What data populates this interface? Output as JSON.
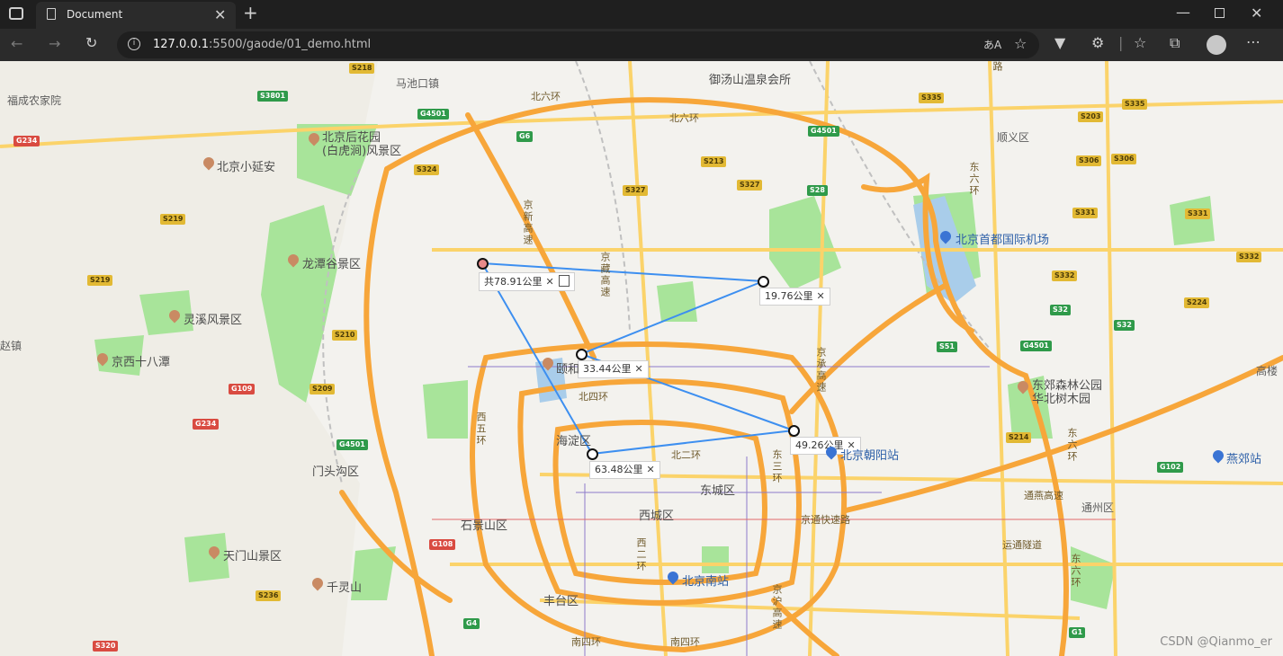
{
  "browser": {
    "tab_title": "Document",
    "url_host": "127.0.0.1",
    "url_rest": ":5500/gaode/01_demo.html",
    "translate_label": "あA"
  },
  "map": {
    "labels": {
      "fucheng": "福成农家院",
      "houhuayuan_1": "北京后花园",
      "houhuayuan_2": "(白虎涧)风景区",
      "xiaoyanan": "北京小延安",
      "longtangu": "龙潭谷景区",
      "lingxi": "灵溪风景区",
      "jingxi18": "京西十八潭",
      "chiqiao": "赵镇",
      "machikou": "马池口镇",
      "yutangshan": "御汤山温泉会所",
      "beiliuhuan_1": "北六环",
      "beiliuhuan_2": "北六环",
      "shunyi": "顺义区",
      "airport": "北京首都国际机场",
      "dongjiao": "东郊森林公园",
      "huabei": "华北树木园",
      "gaolou": "高楼",
      "yanjiao": "燕郊站",
      "tongzhou": "通州区",
      "haidian": "海淀区",
      "mentougou": "门头沟区",
      "shijingshan": "石景山区",
      "fengtai": "丰台区",
      "xicheng": "西城区",
      "dongcheng": "东城区",
      "chaoyang_station": "北京朝阳站",
      "south_station": "北京南站",
      "beisihuan": "北四环",
      "beierhuan": "北二环",
      "nansihuan_1": "南四环",
      "nansihuan_2": "南四环",
      "tongyan": "通燕高速",
      "yuntong": "运通隧道",
      "jingtong": "京通快速路",
      "tianmenshan": "天门山景区",
      "qianlingshan": "千灵山",
      "yihe": "颐和",
      "jingxin": "京新高速",
      "jingzang": "京藏高速",
      "jingcheng": "京承高速",
      "xiwuhuan": "西五环",
      "dongliuhuan_1": "东六环",
      "dongliuhuan_2": "东六环",
      "dongsanhuan": "东三环",
      "xierhuan": "西二环",
      "jinghu": "京沪高速",
      "dongliuhuan_3": "东六环",
      "shunyi_road": "路"
    },
    "shields": {
      "s218": "S218",
      "s3801": "S3801",
      "g4501a": "G4501",
      "g234a": "G234",
      "s219a": "S219",
      "s219b": "S219",
      "g6": "G6",
      "s324": "S324",
      "s213": "S213",
      "s327a": "S327",
      "s327b": "S327",
      "s335a": "S335",
      "s335b": "S335",
      "g4501b": "G4501",
      "s28": "S28",
      "s203": "S203",
      "s306a": "S306",
      "s306b": "S306",
      "s331a": "S331",
      "s331b": "S331",
      "s332a": "S332",
      "s332b": "S332",
      "s32a": "S32",
      "s32b": "S32",
      "s224": "S224",
      "s51": "S51",
      "g4501c": "G4501",
      "s210": "S210",
      "g109": "G109",
      "s209": "S209",
      "g234b": "G234",
      "g4501d": "G4501",
      "s214": "S214",
      "g102": "G102",
      "g108": "G108",
      "s236": "S236",
      "g4": "G4",
      "s320": "S320",
      "g1": "G1"
    },
    "measure": {
      "total": "共78.91公里",
      "seg1": "19.76公里",
      "seg2": "33.44公里",
      "seg3": "49.26公里",
      "seg4": "63.48公里"
    },
    "colors": {
      "ring_road": "#f7a63a",
      "major_road": "#fbd36a",
      "measure_line": "#3d8ff0",
      "green_area": "#a8e49a",
      "water": "#a9cdea"
    }
  },
  "watermark": "CSDN @Qianmo_er"
}
